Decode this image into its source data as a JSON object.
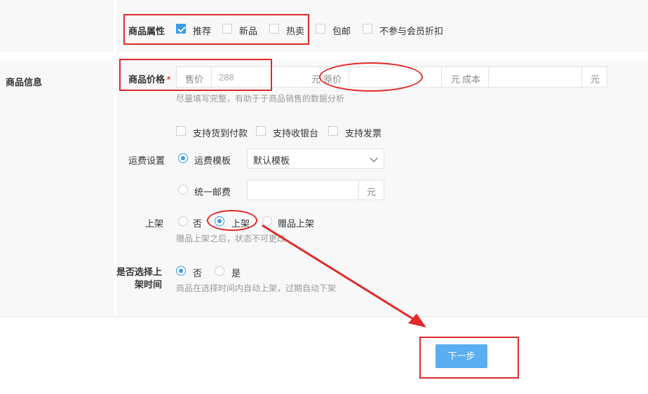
{
  "attributes": {
    "label": "商品属性",
    "options": [
      {
        "label": "推荐",
        "checked": true
      },
      {
        "label": "新品",
        "checked": false
      },
      {
        "label": "热卖",
        "checked": false
      },
      {
        "label": "包邮",
        "checked": false
      },
      {
        "label": "不参与会员折扣",
        "checked": false
      }
    ]
  },
  "section": {
    "title": "商品信息"
  },
  "price": {
    "label": "商品价格",
    "required_mark": "*",
    "sale_prefix": "售价",
    "sale_value": "288",
    "sale_suffix": "元",
    "original_prefix": "原价",
    "original_value": "",
    "original_suffix": "元",
    "cost_prefix": "成本",
    "cost_value": "",
    "cost_suffix": "元",
    "hint": "尽量填写完整，有助于于商品销售的数据分析"
  },
  "support": {
    "options": [
      {
        "label": "支持货到付款",
        "checked": false
      },
      {
        "label": "支持收银台",
        "checked": false
      },
      {
        "label": "支持发票",
        "checked": false
      }
    ]
  },
  "shipping": {
    "label": "运费设置",
    "template_option": "运费模板",
    "template_selected": true,
    "template_value": "默认模板",
    "uniform_option": "统一邮费",
    "uniform_value": "",
    "uniform_suffix": "元"
  },
  "listing": {
    "label": "上架",
    "options": [
      {
        "label": "否",
        "checked": false
      },
      {
        "label": "上架",
        "checked": true
      },
      {
        "label": "赠品上架",
        "checked": false
      }
    ],
    "hint": "赠品上架之后，状态不可更改"
  },
  "schedule": {
    "label_line1": "是否选择上",
    "label_line2": "架时间",
    "options": [
      {
        "label": "否",
        "checked": true
      },
      {
        "label": "是",
        "checked": false
      }
    ],
    "hint": "商品在选择时间内自动上架，过期自动下架"
  },
  "footer": {
    "next_label": "下一步"
  },
  "colors": {
    "accent": "#3a9ce8",
    "annotation": "#e02a2a",
    "button": "#5aaef0"
  }
}
